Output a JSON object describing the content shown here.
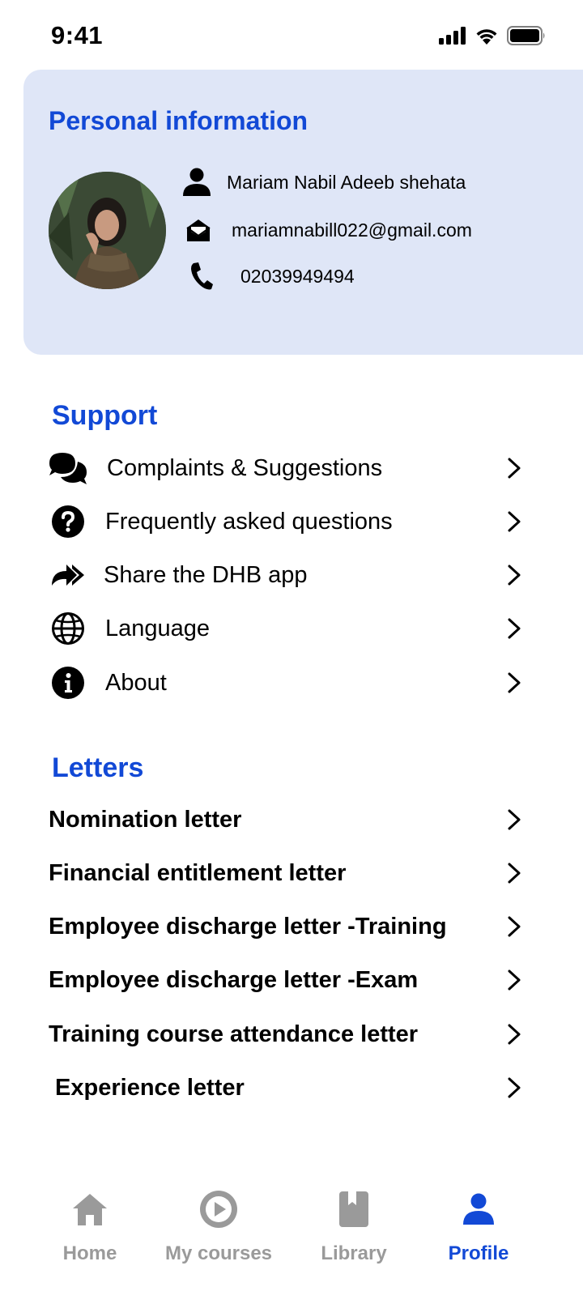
{
  "status_bar": {
    "time": "9:41"
  },
  "personal": {
    "title": "Personal information",
    "name": "Mariam Nabil Adeeb shehata",
    "email": "mariamnabill022@gmail.com",
    "phone": "02039949494"
  },
  "support": {
    "title": "Support",
    "items": [
      {
        "label": "Complaints & Suggestions",
        "icon": "chat-bubbles-icon"
      },
      {
        "label": " Frequently asked questions",
        "icon": "question-circle-icon"
      },
      {
        "label": "Share the DHB app",
        "icon": "share-icon"
      },
      {
        "label": "Language",
        "icon": "globe-icon"
      },
      {
        "label": "About",
        "icon": "info-circle-icon"
      }
    ]
  },
  "letters": {
    "title": "Letters",
    "items": [
      {
        "label": "Nomination letter"
      },
      {
        "label": "Financial entitlement letter"
      },
      {
        "label": "Employee discharge letter -Training"
      },
      {
        "label": "Employee discharge letter -Exam"
      },
      {
        "label": "Training course attendance letter"
      },
      {
        "label": " Experience letter"
      }
    ]
  },
  "tabs": [
    {
      "label": "Home",
      "icon": "home-icon",
      "active": false
    },
    {
      "label": "My courses",
      "icon": "play-circle-icon",
      "active": false
    },
    {
      "label": "Library",
      "icon": "book-icon",
      "active": false
    },
    {
      "label": "Profile",
      "icon": "person-icon",
      "active": true
    }
  ],
  "colors": {
    "accent": "#1249d6",
    "card_background": "#dfe6f7",
    "tab_inactive": "#9a9a9a"
  }
}
